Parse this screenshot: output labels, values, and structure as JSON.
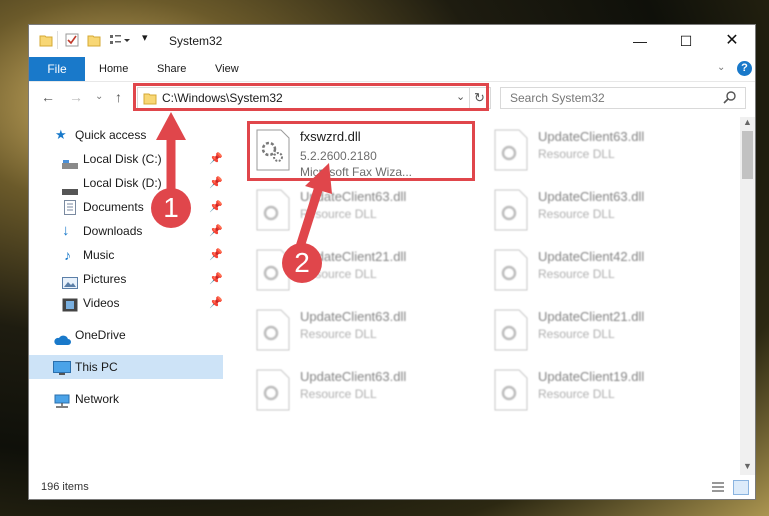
{
  "window": {
    "title": "System32"
  },
  "ribbon": {
    "file": "File",
    "tabs": [
      "Home",
      "Share",
      "View"
    ]
  },
  "address": {
    "path": "C:\\Windows\\System32"
  },
  "search": {
    "placeholder": "Search System32"
  },
  "sidebar": {
    "items": [
      {
        "label": "Quick access",
        "pinned": false
      },
      {
        "label": "Local Disk (C:)",
        "pinned": true
      },
      {
        "label": "Local Disk (D:)",
        "pinned": true
      },
      {
        "label": "Documents",
        "pinned": true
      },
      {
        "label": "Downloads",
        "pinned": true
      },
      {
        "label": "Music",
        "pinned": true
      },
      {
        "label": "Pictures",
        "pinned": true
      },
      {
        "label": "Videos",
        "pinned": true
      },
      {
        "label": "OneDrive",
        "pinned": false
      },
      {
        "label": "This PC",
        "pinned": false,
        "selected": true
      },
      {
        "label": "Network",
        "pinned": false
      }
    ]
  },
  "files": [
    {
      "name": "fxswzrd.dll",
      "line1": "5.2.2600.2180",
      "line2": "Microsoft  Fax Wiza..."
    },
    {
      "name": "UpdateClient63.dll",
      "line1": "Resource DLL"
    },
    {
      "name": "UpdateClient63.dll",
      "line1": "Resource DLL"
    },
    {
      "name": "UpdateClient63.dll",
      "line1": "Resource DLL"
    },
    {
      "name": "UpdateClient21.dll",
      "line1": "Resource DLL"
    },
    {
      "name": "UpdateClient42.dll",
      "line1": "Resource DLL"
    },
    {
      "name": "UpdateClient63.dll",
      "line1": "Resource DLL"
    },
    {
      "name": "UpdateClient21.dll",
      "line1": "Resource DLL"
    },
    {
      "name": "UpdateClient63.dll",
      "line1": "Resource DLL"
    },
    {
      "name": "UpdateClient19.dll",
      "line1": "Resource DLL"
    }
  ],
  "status": {
    "items": "196 items"
  },
  "annotations": {
    "step1": "1",
    "step2": "2",
    "color": "#e0464b"
  }
}
